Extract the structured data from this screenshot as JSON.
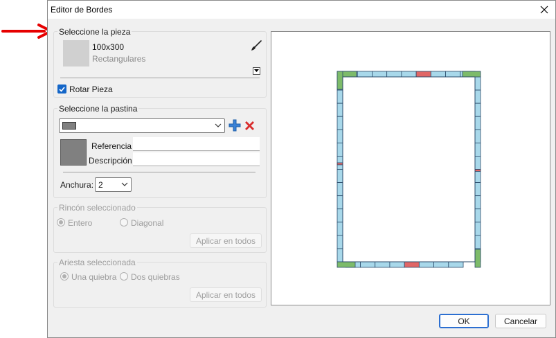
{
  "dialog": {
    "title": "Editor de Bordes"
  },
  "piece_group": {
    "label": "Seleccione la pieza",
    "size": "100x300",
    "type": "Rectangulares",
    "rotate_label": "Rotar Pieza",
    "rotate_checked": true
  },
  "pastina_group": {
    "label": "Seleccione la pastina",
    "selected_swatch_color": "#808080",
    "ref_label": "Referencia",
    "ref_value": "",
    "desc_label": "Descripción",
    "desc_value": "",
    "width_label": "Anchura:",
    "width_value": "2"
  },
  "corner_group": {
    "label": "Rincón seleccionado",
    "opt_entero": "Entero",
    "opt_diagonal": "Diagonal",
    "selected": "Entero",
    "apply_label": "Aplicar en todos"
  },
  "edge_group": {
    "label": "Ariesta seleccionada",
    "opt_una": "Una quiebra",
    "opt_dos": "Dos quiebras",
    "selected": "Una quiebra",
    "apply_label": "Aplicar en todos"
  },
  "footer": {
    "ok_label": "OK",
    "cancel_label": "Cancelar"
  },
  "colors": {
    "tile_blue": "#a8d8ea",
    "tile_red": "#e06666",
    "tile_green": "#7dbb6a",
    "annotation_red": "#e60000",
    "accent": "#1466c8"
  },
  "icons": [
    "arrow-annotation",
    "brush-icon",
    "dropdown-arrow-icon",
    "plus-icon",
    "delete-icon",
    "close-icon"
  ]
}
